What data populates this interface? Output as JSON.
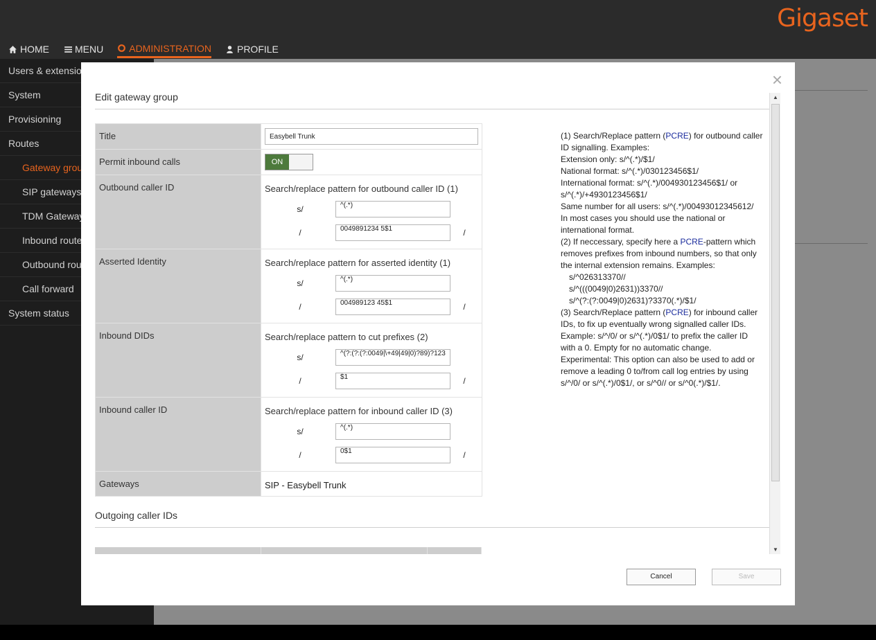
{
  "brand": "Gigaset",
  "nav": {
    "home": "HOME",
    "menu": "MENU",
    "administration": "ADMINISTRATION",
    "profile": "PROFILE"
  },
  "sidebar": {
    "items": [
      {
        "label": "Users & extensions",
        "sub": false,
        "active": false
      },
      {
        "label": "System",
        "sub": false,
        "active": false
      },
      {
        "label": "Provisioning",
        "sub": false,
        "active": false
      },
      {
        "label": "Routes",
        "sub": false,
        "active": false
      },
      {
        "label": "Gateway groups",
        "sub": true,
        "active": true
      },
      {
        "label": "SIP gateways",
        "sub": true,
        "active": false
      },
      {
        "label": "TDM Gateways",
        "sub": true,
        "active": false
      },
      {
        "label": "Inbound routes",
        "sub": true,
        "active": false
      },
      {
        "label": "Outbound routes",
        "sub": true,
        "active": false
      },
      {
        "label": "Call forward",
        "sub": true,
        "active": false
      },
      {
        "label": "System status",
        "sub": false,
        "active": false
      }
    ]
  },
  "modal": {
    "close": "×",
    "title": "Edit gateway group",
    "form": {
      "title_label": "Title",
      "title_value": "Easybell Trunk",
      "permit_label": "Permit inbound calls",
      "permit_state": "ON",
      "outbound_label": "Outbound caller ID",
      "outbound_pattern_title": "Search/replace pattern for outbound caller ID (1)",
      "outbound_search": "^(.*)",
      "outbound_replace": "0049891234 5$1",
      "asserted_label": "Asserted Identity",
      "asserted_pattern_title": "Search/replace pattern for asserted identity (1)",
      "asserted_search": "^(.*)",
      "asserted_replace": "004989123 45$1",
      "dids_label": "Inbound DIDs",
      "dids_pattern_title": "Search/replace pattern to cut prefixes (2)",
      "dids_search": "^(?:(?:(?:0049|\\+49|49|0)?89)?123",
      "dids_replace": "$1",
      "inbound_label": "Inbound caller ID",
      "inbound_pattern_title": "Search/replace pattern for inbound caller ID (3)",
      "inbound_search": "^(.*)",
      "inbound_replace": "0$1",
      "gateways_label": "Gateways",
      "gateways_value": "SIP - Easybell Trunk",
      "s_prefix": "s/",
      "slash": "/"
    },
    "help": {
      "p1a": "(1) Search/Replace pattern (",
      "pcre": "PCRE",
      "p1b": ") for outbound caller ID signalling. Examples:",
      "l1": "Extension only: s/^(.*)/$1/",
      "l2": "National format: s/^(.*)/030123456$1/",
      "l3": "International format: s/^(.*)/004930123456$1/ or s/^(.*)/+4930123456$1/",
      "l4": "Same number for all users: s/^(.*)/00493012345612/",
      "l5": "In most cases you should use the national or international format.",
      "p2a": "(2) If neccessary, specify here a ",
      "p2b": "-pattern which removes prefixes from inbound numbers, so that only the internal extension remains. Examples:",
      "e1": "s/^026313370//",
      "e2": "s/^(((0049|0)2631))3370//",
      "e3": "s/^(?:(?:0049|0)2631)?3370(.*)/$1/",
      "p3a": "(3) Search/Replace pattern (",
      "p3b": ") for inbound caller IDs, to fix up eventually wrong signalled caller IDs. Example: s/^/0/ or s/^(.*)/0$1/ to prefix the caller ID with a 0. Empty for no automatic change. Experimental: This option can also be used to add or remove a leading 0 to/from call log entries by using s/^/0/ or s/^(.*)/0$1/, or s/^0// or s/^0(.*)/$1/."
    },
    "section2_title": "Outgoing caller IDs",
    "buttons": {
      "cancel": "Cancel",
      "save": "Save"
    }
  }
}
